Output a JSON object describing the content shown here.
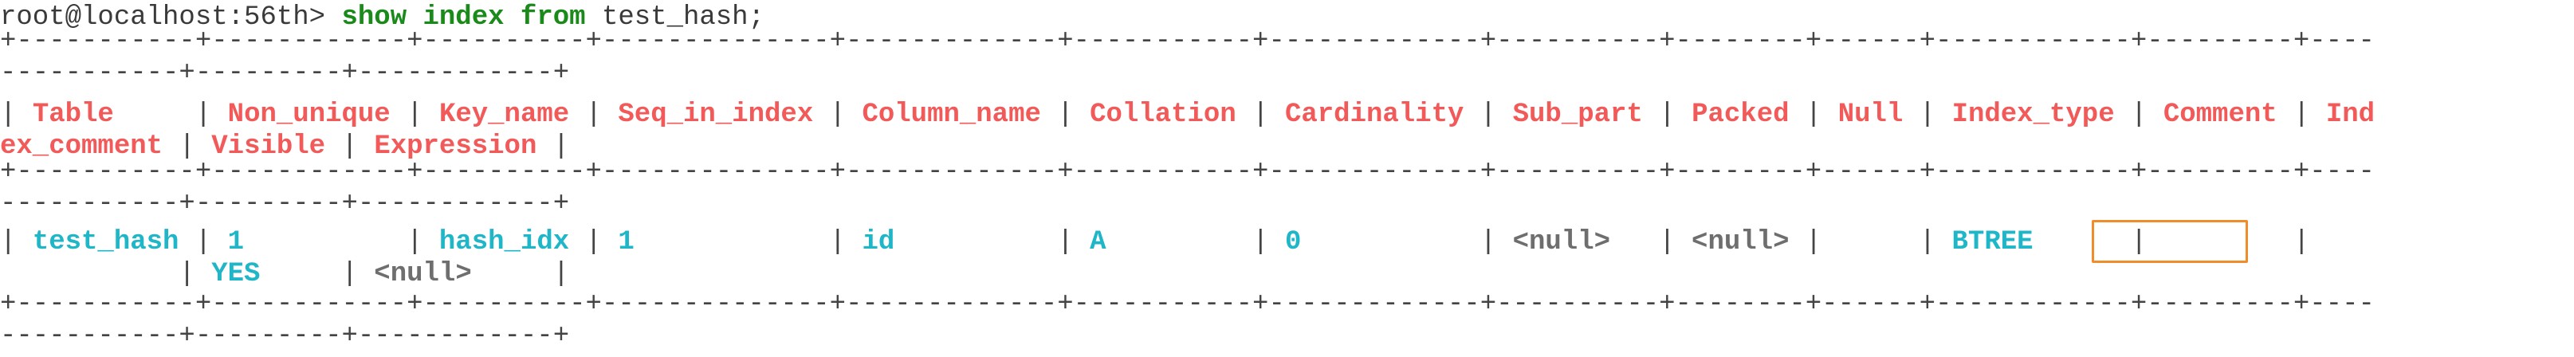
{
  "prompt": {
    "text": "root@localhost:56th> ",
    "command_keywords": "show index from",
    "command_argument": " test_hash;"
  },
  "table": {
    "border_line_1": "+-----------+------------+----------+--------------+-------------+-----------+-------------+----------+--------+------+------------+---------+----",
    "border_line_2": "-----------+---------+------------+",
    "header_columns": [
      "Table",
      "Non_unique",
      "Key_name",
      "Seq_in_index",
      "Column_name",
      "Collation",
      "Cardinality",
      "Sub_part",
      "Packed",
      "Null",
      "Index_type",
      "Comment",
      "Ind"
    ],
    "header_continuation": [
      "ex_comment",
      "Visible",
      "Expression"
    ],
    "row": {
      "table": "test_hash",
      "non_unique": "1",
      "key_name": "hash_idx",
      "seq_in_index": "1",
      "column_name": "id",
      "collation": "A",
      "cardinality": "0",
      "sub_part": "<null>",
      "packed": "<null>",
      "null": "",
      "index_type": "BTREE",
      "comment": "",
      "visible": "YES",
      "expression": "<null>"
    }
  },
  "colors": {
    "header": "#f25a5a",
    "value": "#1fb6c8",
    "null_value": "#6e6e6e",
    "keyword": "#1a8a1a",
    "highlight": "#f08c2a"
  }
}
